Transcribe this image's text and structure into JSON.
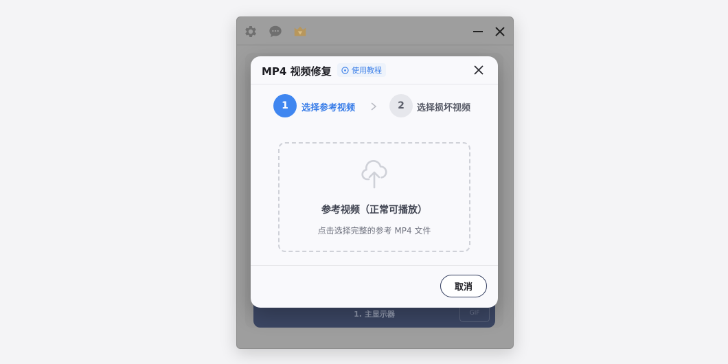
{
  "app_window": {
    "toolbar_icons": [
      "gear-icon",
      "chat-icon",
      "vip-crown-icon"
    ],
    "controls": [
      "minimize-icon",
      "close-icon"
    ],
    "monitor_label": "1. 主显示器",
    "gif_label": "GIF"
  },
  "dialog": {
    "title": "MP4 视频修复",
    "tutorial_label": "使用教程",
    "tutorial_icon": "info-icon",
    "close_icon": "close-icon",
    "steps": [
      {
        "number": "1",
        "label": "选择参考视频",
        "active": true
      },
      {
        "number": "2",
        "label": "选择损坏视频",
        "active": false
      }
    ],
    "step_separator_icon": "chevron-right-icon",
    "dropzone": {
      "icon": "cloud-upload-icon",
      "title": "参考视频（正常可播放）",
      "subtitle": "点击选择完整的参考 MP4 文件"
    },
    "cancel_label": "取消"
  },
  "colors": {
    "accent": "#3f86f0",
    "overlay_window": "#9e9e9e",
    "monitor_bar": "#3b4663",
    "vip_icon": "#c9a567"
  }
}
